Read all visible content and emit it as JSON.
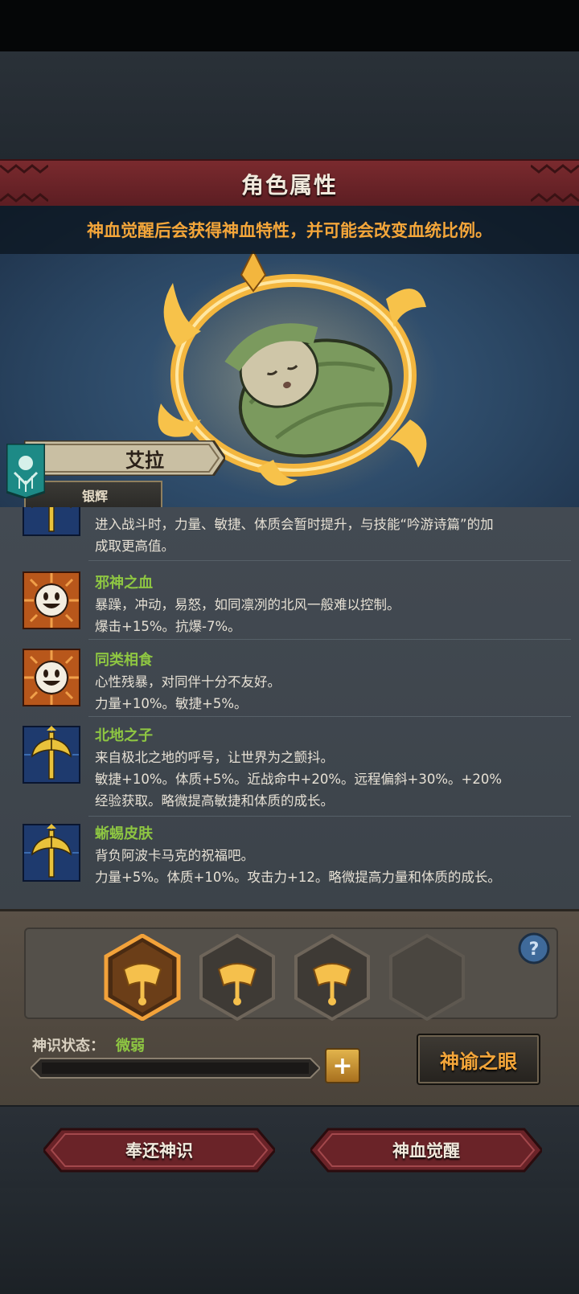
{
  "header": {
    "title": "角色属性"
  },
  "hero": {
    "notice": "神血觉醒后会获得神血特性，并可能会改变血统比例。",
    "character_name": "艾拉",
    "character_title": "银辉"
  },
  "traits": [
    {
      "name": "",
      "icon": "axe-icon",
      "lines": [
        "进入战斗时，力量、敏捷、体质会暂时提升，与技能“吟游诗篇”的加",
        "成取更高值。"
      ]
    },
    {
      "name": "邪神之血",
      "icon": "smiley-icon",
      "lines": [
        "暴躁，冲动，易怒，如同凛冽的北风一般难以控制。",
        "爆击+15%。抗爆-7%。"
      ]
    },
    {
      "name": "同类相食",
      "icon": "smiley-icon",
      "lines": [
        "心性残暴，对同伴十分不友好。",
        "力量+10%。敏捷+5%。"
      ]
    },
    {
      "name": "北地之子",
      "icon": "axe-icon",
      "lines": [
        "来自极北之地的呼号，让世界为之颤抖。",
        "敏捷+10%。体质+5%。近战命中+20%。远程偏斜+30%。+20%",
        "经验获取。略微提高敏捷和体质的成长。"
      ]
    },
    {
      "name": "蜥蜴皮肤",
      "icon": "axe-icon",
      "lines": [
        "背负阿波卡马克的祝福吧。",
        "力量+5%。体质+10%。攻击力+12。略微提高力量和体质的成长。"
      ]
    }
  ],
  "panel": {
    "slots": [
      "crown-icon",
      "crown-icon",
      "crown-icon",
      "empty-slot"
    ],
    "status_label": "神识状态：",
    "status_value": "微弱",
    "progress": 0,
    "plus": "+",
    "oracle_button": "神谕之眼"
  },
  "footer": {
    "return_button": "奉还神识",
    "awaken_button": "神血觉醒"
  },
  "colors": {
    "accent_orange": "#f4a63a",
    "trait_green": "#8ec642",
    "title_red": "#6a2328"
  }
}
